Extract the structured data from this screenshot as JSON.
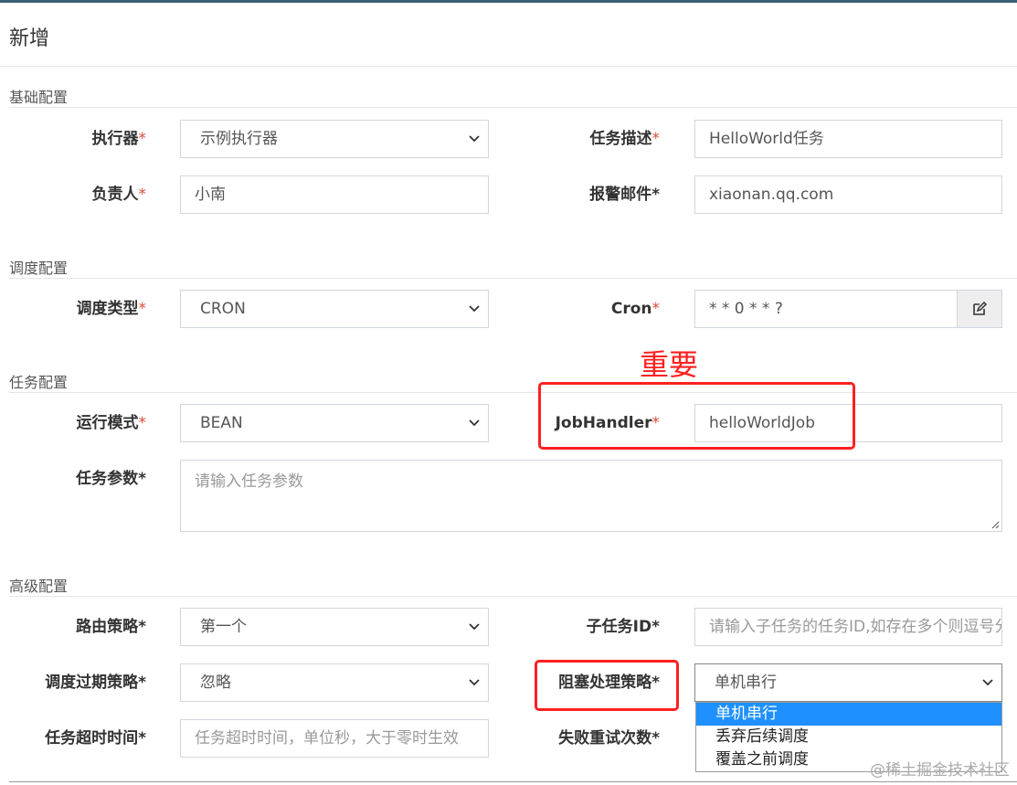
{
  "modal": {
    "title": "新增"
  },
  "sections": {
    "basic": "基础配置",
    "schedule": "调度配置",
    "task": "任务配置",
    "advanced": "高级配置"
  },
  "fields": {
    "executor": {
      "label": "执行器",
      "value": "示例执行器"
    },
    "job_desc": {
      "label": "任务描述",
      "value": "HelloWorld任务"
    },
    "owner": {
      "label": "负责人",
      "value": "小南"
    },
    "alarm_email": {
      "label": "报警邮件",
      "value": "xiaonan.qq.com"
    },
    "schedule_type": {
      "label": "调度类型",
      "value": "CRON"
    },
    "cron": {
      "label": "Cron",
      "value": "* * 0 * * ?"
    },
    "run_mode": {
      "label": "运行模式",
      "value": "BEAN"
    },
    "job_handler": {
      "label": "JobHandler",
      "value": "helloWorldJob"
    },
    "job_param": {
      "label": "任务参数",
      "placeholder": "请输入任务参数"
    },
    "route_strategy": {
      "label": "路由策略",
      "value": "第一个"
    },
    "child_job_id": {
      "label": "子任务ID",
      "placeholder": "请输入子任务的任务ID,如存在多个则逗号分隔"
    },
    "misfire_strategy": {
      "label": "调度过期策略",
      "value": "忽略"
    },
    "block_strategy": {
      "label": "阻塞处理策略",
      "value": "单机串行"
    },
    "timeout": {
      "label": "任务超时时间",
      "placeholder": "任务超时时间，单位秒，大于零时生效"
    },
    "fail_retry": {
      "label": "失败重试次数"
    }
  },
  "required_mark": "*",
  "block_strategy_options": [
    "单机串行",
    "丢弃后续调度",
    "覆盖之前调度"
  ],
  "annotation": {
    "text": "重要",
    "color": "#ff2020"
  },
  "watermark": "@稀土掘金技术社区",
  "icons": {
    "cron_edit": "edit-icon",
    "select_arrow": "chevron-down-icon"
  },
  "colors": {
    "required": "#dd4b39",
    "highlight": "#ff2020",
    "option_selected": "#1e90ff"
  }
}
